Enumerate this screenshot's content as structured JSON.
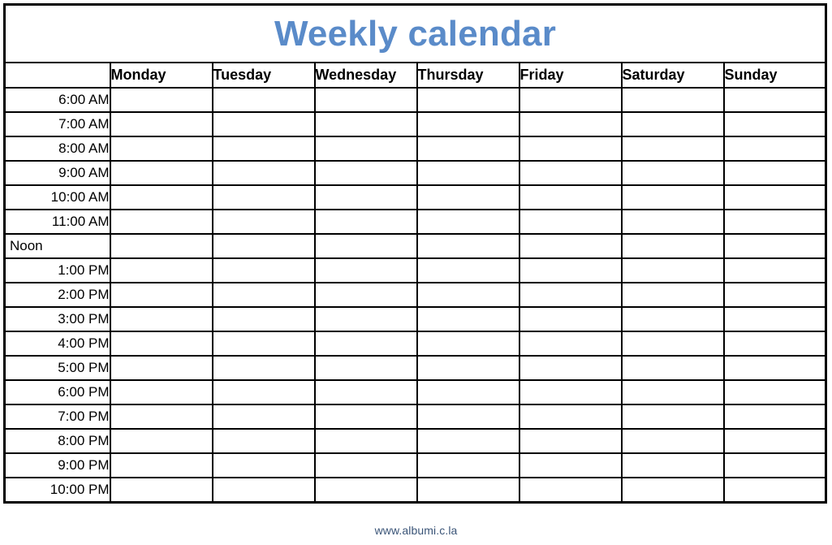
{
  "document": {
    "title": "Weekly calendar",
    "title_color": "#5A8BC9"
  },
  "table": {
    "corner_label": "",
    "day_headers": [
      "Monday",
      "Tuesday",
      "Wednesday",
      "Thursday",
      "Friday",
      "Saturday",
      "Sunday"
    ],
    "time_rows": [
      {
        "label": "6:00 AM",
        "align": "right"
      },
      {
        "label": "7:00 AM",
        "align": "right"
      },
      {
        "label": "8:00 AM",
        "align": "right"
      },
      {
        "label": "9:00 AM",
        "align": "right"
      },
      {
        "label": "10:00 AM",
        "align": "right"
      },
      {
        "label": "11:00 AM",
        "align": "right"
      },
      {
        "label": "Noon",
        "align": "left"
      },
      {
        "label": "1:00 PM",
        "align": "right"
      },
      {
        "label": "2:00 PM",
        "align": "right"
      },
      {
        "label": "3:00 PM",
        "align": "right"
      },
      {
        "label": "4:00 PM",
        "align": "right"
      },
      {
        "label": "5:00 PM",
        "align": "right"
      },
      {
        "label": "6:00 PM",
        "align": "right"
      },
      {
        "label": "7:00 PM",
        "align": "right"
      },
      {
        "label": "8:00 PM",
        "align": "right"
      },
      {
        "label": "9:00 PM",
        "align": "right"
      },
      {
        "label": "10:00 PM",
        "align": "right"
      }
    ],
    "cells": [
      [
        "",
        "",
        "",
        "",
        "",
        "",
        ""
      ],
      [
        "",
        "",
        "",
        "",
        "",
        "",
        ""
      ],
      [
        "",
        "",
        "",
        "",
        "",
        "",
        ""
      ],
      [
        "",
        "",
        "",
        "",
        "",
        "",
        ""
      ],
      [
        "",
        "",
        "",
        "",
        "",
        "",
        ""
      ],
      [
        "",
        "",
        "",
        "",
        "",
        "",
        ""
      ],
      [
        "",
        "",
        "",
        "",
        "",
        "",
        ""
      ],
      [
        "",
        "",
        "",
        "",
        "",
        "",
        ""
      ],
      [
        "",
        "",
        "",
        "",
        "",
        "",
        ""
      ],
      [
        "",
        "",
        "",
        "",
        "",
        "",
        ""
      ],
      [
        "",
        "",
        "",
        "",
        "",
        "",
        ""
      ],
      [
        "",
        "",
        "",
        "",
        "",
        "",
        ""
      ],
      [
        "",
        "",
        "",
        "",
        "",
        "",
        ""
      ],
      [
        "",
        "",
        "",
        "",
        "",
        "",
        ""
      ],
      [
        "",
        "",
        "",
        "",
        "",
        "",
        ""
      ],
      [
        "",
        "",
        "",
        "",
        "",
        "",
        ""
      ],
      [
        "",
        "",
        "",
        "",
        "",
        "",
        ""
      ]
    ]
  },
  "footer": {
    "url": "www.albumi.c.la"
  }
}
